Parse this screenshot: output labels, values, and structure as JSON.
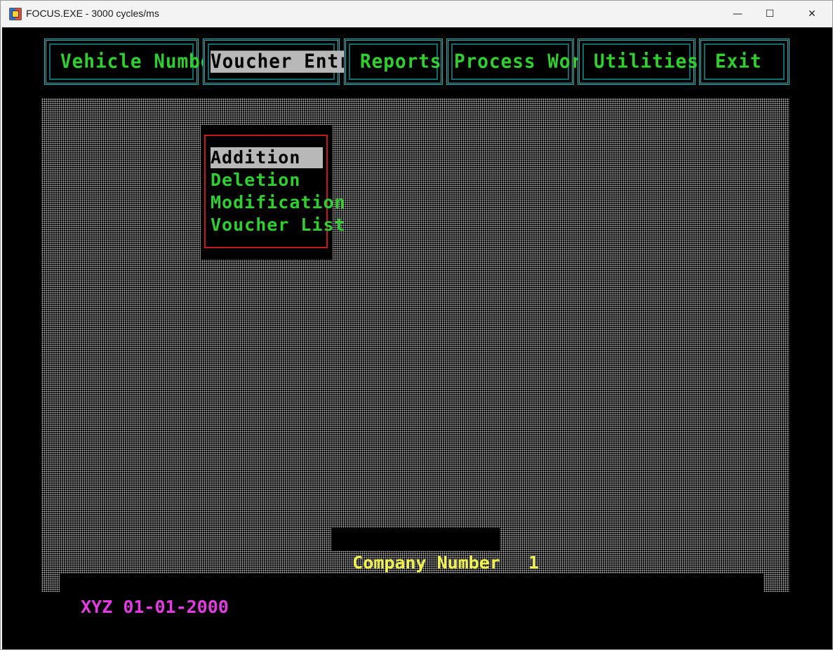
{
  "window": {
    "title": "FOCUS.EXE - 3000 cycles/ms",
    "minimize_glyph": "—",
    "maximize_glyph": "☐",
    "close_glyph": "✕"
  },
  "menu": {
    "items": [
      {
        "label": "Vehicle Number",
        "active": false
      },
      {
        "label": "Voucher Entry",
        "active": true
      },
      {
        "label": "Reports",
        "active": false
      },
      {
        "label": "Process Work",
        "active": false
      },
      {
        "label": "Utilities",
        "active": false
      },
      {
        "label": "Exit",
        "active": false
      }
    ]
  },
  "dropdown": {
    "items": [
      {
        "label": "Addition",
        "active": true
      },
      {
        "label": "Deletion",
        "active": false
      },
      {
        "label": "Modification",
        "active": false
      },
      {
        "label": "Voucher List",
        "active": false
      }
    ]
  },
  "company": {
    "label": "Company Number",
    "value": "1"
  },
  "status": {
    "text": "XYZ 01-01-2000"
  },
  "colors": {
    "menu_text": "#2fcf2f",
    "menu_border": "#1fb5b5",
    "highlight": "#b8b8b8",
    "dropdown_border": "#c41a1a",
    "company_text": "#f0f04a",
    "status_text": "#e23be2"
  }
}
